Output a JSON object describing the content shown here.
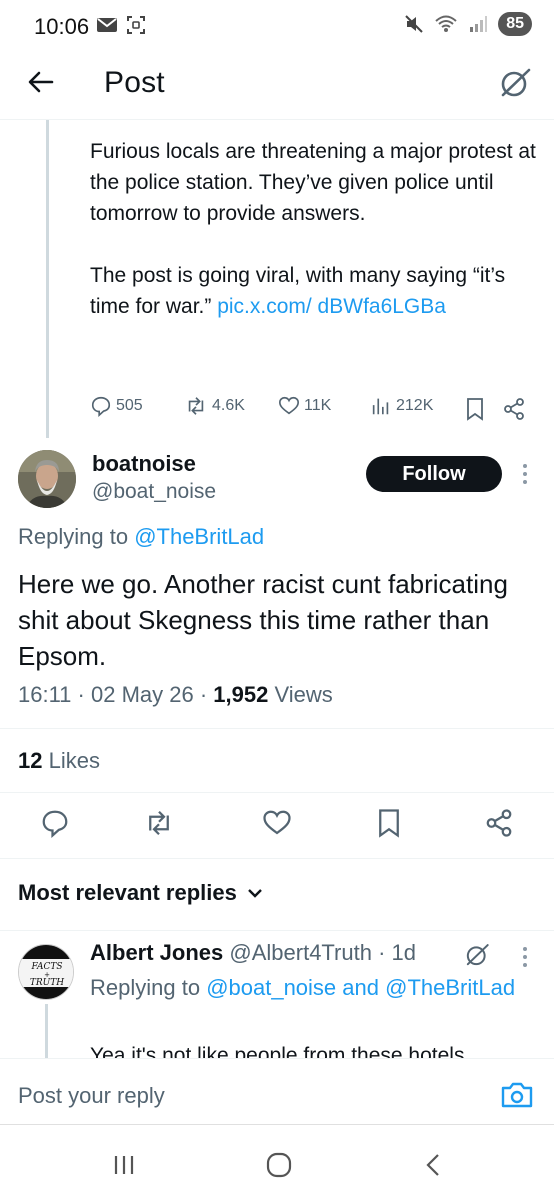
{
  "status_bar": {
    "time": "10:06",
    "battery": "85",
    "network": "5"
  },
  "header": {
    "title": "Post"
  },
  "previous_post": {
    "paragraph1": "Furious locals are threatening a major protest at the police station. They’ve given police until tomorrow to provide answers.",
    "paragraph2_text": "The post is going viral, with many saying “it’s time for war.” ",
    "paragraph2_link": "pic.x.com/ dBWfa6LGBa",
    "replies": "505",
    "reposts": "4.6K",
    "likes": "11K",
    "views": "212K"
  },
  "post": {
    "author_name": "boatnoise",
    "author_handle": "@boat_noise",
    "follow_label": "Follow",
    "replying_prefix": "Replying to ",
    "replying_to": "@TheBritLad",
    "text": "Here we go. Another racist cunt fabricating shit about Skegness this time rather than Epsom.",
    "time": "16:11",
    "date": "02 May 26",
    "views_count": "1,952",
    "views_label": " Views",
    "likes_count": "12",
    "likes_label": " Likes"
  },
  "replies_section": {
    "sort_label": "Most relevant replies"
  },
  "reply": {
    "author_name": "Albert Jones",
    "author_handle": "@Albert4Truth",
    "age": "· 1d",
    "replying_prefix": "Replying to ",
    "replying_to1": "@boat_noise",
    "replying_and": " and ",
    "replying_to2": "@TheBritLad",
    "text": "Yea it's not like people from these hotels",
    "avatar_text1": "FACTS",
    "avatar_text2": "+",
    "avatar_text3": "TRUTH"
  },
  "composer": {
    "placeholder": "Post your reply"
  },
  "colors": {
    "accent": "#1d9bf0",
    "secondary_text": "#536471",
    "primary_text": "#0f1419"
  },
  "icons": [
    "back-arrow-icon",
    "grok-icon",
    "reply-icon",
    "repost-icon",
    "like-icon",
    "views-icon",
    "bookmark-icon",
    "share-icon",
    "more-icon",
    "chevron-down-icon",
    "camera-icon"
  ]
}
